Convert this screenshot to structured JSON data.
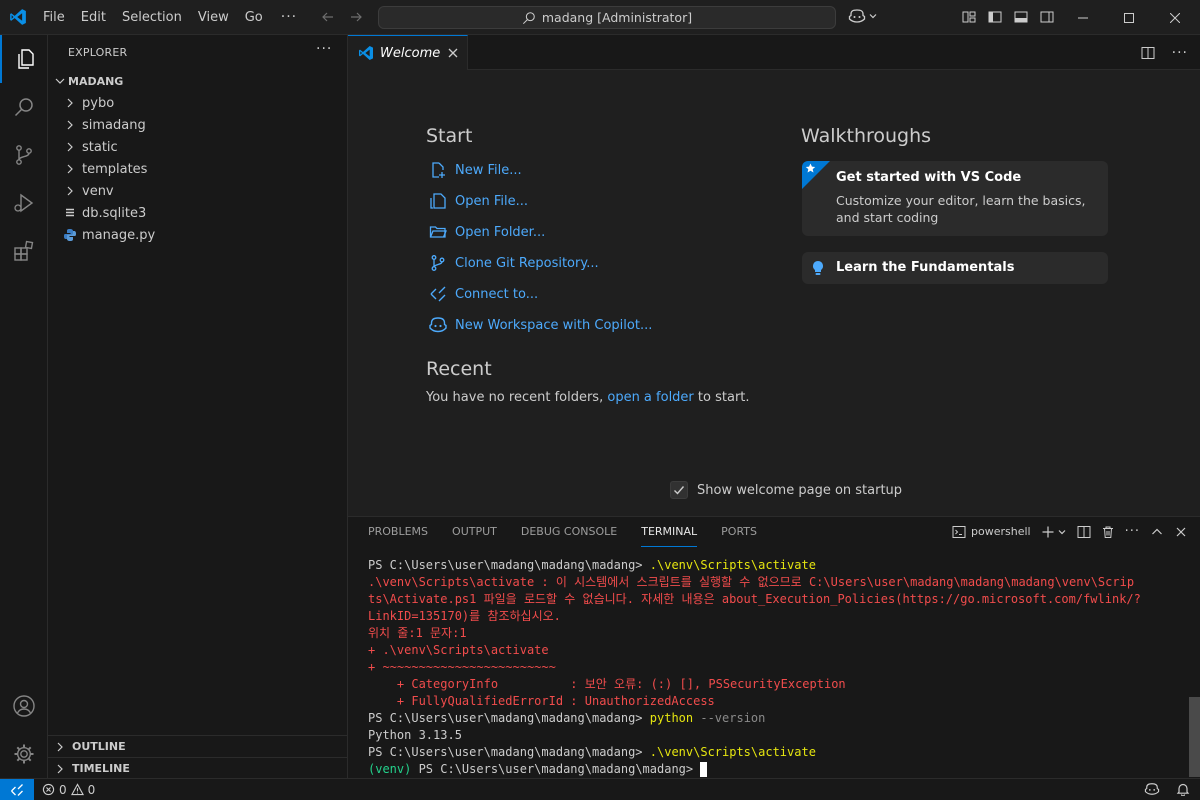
{
  "window": {
    "search_text": "madang [Administrator]"
  },
  "menu": [
    "File",
    "Edit",
    "Selection",
    "View",
    "Go"
  ],
  "menu_more": "···",
  "sidebar": {
    "title": "EXPLORER",
    "more": "···",
    "folder": "MADANG",
    "items": [
      {
        "label": "pybo",
        "type": "folder"
      },
      {
        "label": "simadang",
        "type": "folder"
      },
      {
        "label": "static",
        "type": "folder"
      },
      {
        "label": "templates",
        "type": "folder"
      },
      {
        "label": "venv",
        "type": "folder"
      },
      {
        "label": "db.sqlite3",
        "type": "file-db"
      },
      {
        "label": "manage.py",
        "type": "file-python"
      }
    ],
    "outline": "OUTLINE",
    "timeline": "TIMELINE"
  },
  "tab": {
    "label": "Welcome"
  },
  "welcome": {
    "start_heading": "Start",
    "start_items": [
      {
        "label": "New File...",
        "icon": "new-file-icon"
      },
      {
        "label": "Open File...",
        "icon": "open-file-icon"
      },
      {
        "label": "Open Folder...",
        "icon": "open-folder-icon"
      },
      {
        "label": "Clone Git Repository...",
        "icon": "git-branch-icon"
      },
      {
        "label": "Connect to...",
        "icon": "remote-icon"
      },
      {
        "label": "New Workspace with Copilot...",
        "icon": "copilot-icon"
      }
    ],
    "recent_heading": "Recent",
    "recent_prefix": "You have no recent folders,",
    "recent_link": "open a folder",
    "recent_suffix": "to start.",
    "walkthroughs_heading": "Walkthroughs",
    "card1_title": "Get started with VS Code",
    "card1_desc": "Customize your editor, learn the basics, and start coding",
    "card2_title": "Learn the Fundamentals",
    "show_on_startup": "Show welcome page on startup",
    "show_on_startup_checked": true
  },
  "panel": {
    "tabs": [
      "PROBLEMS",
      "OUTPUT",
      "DEBUG CONSOLE",
      "TERMINAL",
      "PORTS"
    ],
    "active_tab": "TERMINAL",
    "shell": "powershell"
  },
  "terminal": {
    "lines": [
      [
        {
          "t": "PS C:\\Users\\user\\madang\\madang\\madang> ",
          "c": "t-norm"
        },
        {
          "t": ".\\venv\\Scripts\\activate",
          "c": "t-yel"
        }
      ],
      [
        {
          "t": ".\\venv\\Scripts\\activate : 이 시스템에서 스크립트를 실행할 수 없으므로 C:\\Users\\user\\madang\\madang\\madang\\venv\\Scrip",
          "c": "t-err"
        }
      ],
      [
        {
          "t": "ts\\Activate.ps1 파일을 로드할 수 없습니다. 자세한 내용은 about_Execution_Policies(https://go.microsoft.com/fwlink/?",
          "c": "t-err"
        }
      ],
      [
        {
          "t": "LinkID=135170)를 참조하십시오.",
          "c": "t-err"
        }
      ],
      [
        {
          "t": "위치 줄:1 문자:1",
          "c": "t-err"
        }
      ],
      [
        {
          "t": "+ .\\venv\\Scripts\\activate",
          "c": "t-err"
        }
      ],
      [
        {
          "t": "+ ~~~~~~~~~~~~~~~~~~~~~~~~",
          "c": "t-err"
        }
      ],
      [
        {
          "t": "    + CategoryInfo          : 보안 오류: (:) [], PSSecurityException",
          "c": "t-err"
        }
      ],
      [
        {
          "t": "    + FullyQualifiedErrorId : UnauthorizedAccess",
          "c": "t-err"
        }
      ],
      [
        {
          "t": "PS C:\\Users\\user\\madang\\madang\\madang> ",
          "c": "t-norm"
        },
        {
          "t": "python",
          "c": "t-yel"
        },
        {
          "t": " --version",
          "c": "t-dim"
        }
      ],
      [
        {
          "t": "Python 3.13.5",
          "c": "t-norm"
        }
      ],
      [
        {
          "t": "PS C:\\Users\\user\\madang\\madang\\madang> ",
          "c": "t-norm"
        },
        {
          "t": ".\\venv\\Scripts\\activate",
          "c": "t-yel"
        }
      ],
      [
        {
          "t": "(venv) ",
          "c": "t-grn"
        },
        {
          "t": "PS C:\\Users\\user\\madang\\madang\\madang> ",
          "c": "t-norm"
        }
      ]
    ]
  },
  "status": {
    "errors": "0",
    "warnings": "0"
  },
  "colors": {
    "accent": "#0078d4",
    "link": "#4daafc",
    "error": "#f14c4c",
    "command": "#e5e510",
    "venv": "#23d18b"
  }
}
